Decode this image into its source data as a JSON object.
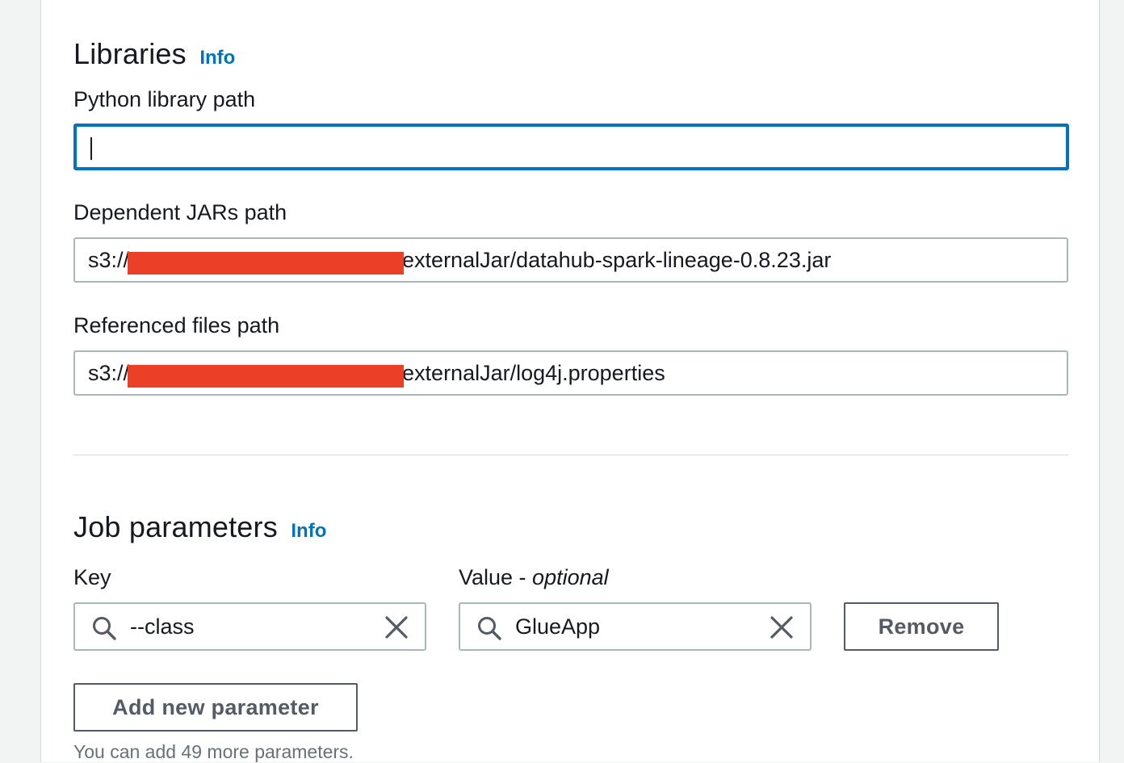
{
  "libraries": {
    "title": "Libraries",
    "info": "Info",
    "python_path": {
      "label": "Python library path",
      "value": ""
    },
    "jars_path": {
      "label": "Dependent JARs path",
      "prefix": "s3://",
      "suffix": "externalJar/datahub-spark-lineage-0.8.23.jar"
    },
    "files_path": {
      "label": "Referenced files path",
      "prefix": "s3://",
      "suffix": "externalJar/log4j.properties"
    }
  },
  "job_parameters": {
    "title": "Job parameters",
    "info": "Info",
    "key_label": "Key",
    "value_label": "Value - ",
    "value_label_optional": "optional",
    "rows": [
      {
        "key": "--class",
        "value": "GlueApp",
        "remove_label": "Remove"
      }
    ],
    "add_label": "Add new parameter",
    "hint": "You can add 49 more parameters."
  },
  "colors": {
    "link": "#0073bb",
    "focus": "#0073bb",
    "redaction": "#eb3f28",
    "border": "#aab7b8",
    "button": "#545b64"
  },
  "icons": {
    "search": "search-icon",
    "clear": "close-icon"
  }
}
